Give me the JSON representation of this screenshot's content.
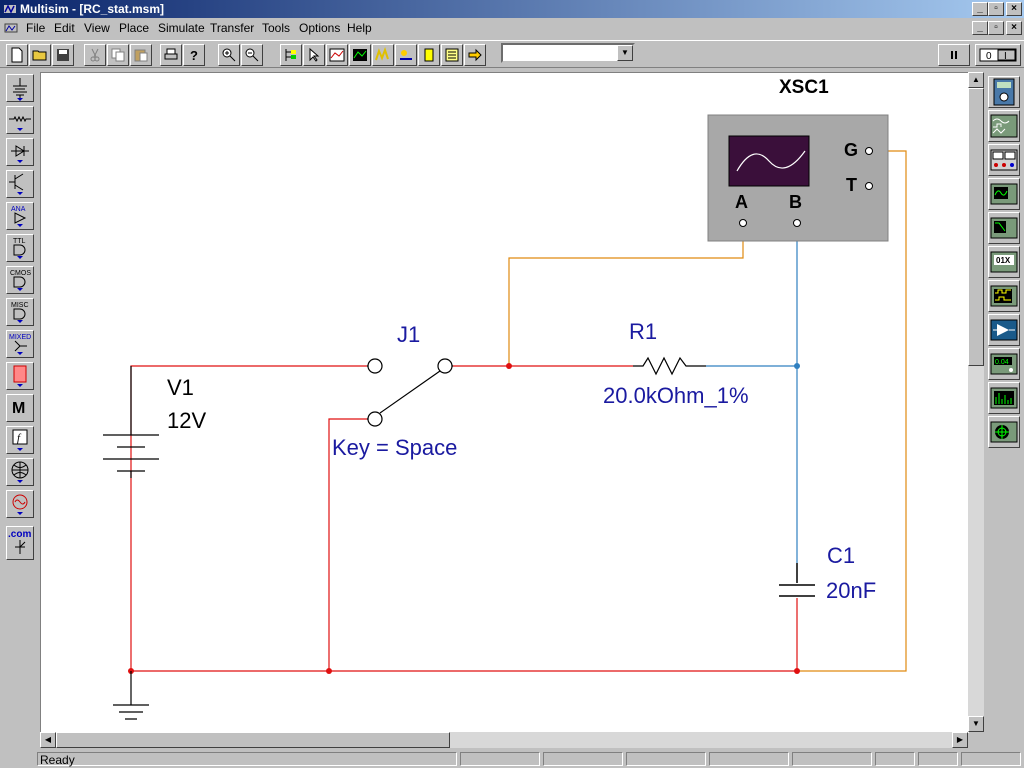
{
  "window": {
    "title": "Multisim - [RC_stat.msm]"
  },
  "menu": {
    "items": [
      "File",
      "Edit",
      "View",
      "Place",
      "Simulate",
      "Transfer",
      "Tools",
      "Options",
      "Help"
    ]
  },
  "toolbar": {
    "combo_value": ""
  },
  "left_toolbar": {
    "items": [
      "sources-icon",
      "basic-icon",
      "diodes-icon",
      "transistors-icon",
      "analog-icon",
      "ttl-icon",
      "cmos-icon",
      "misc-digital-icon",
      "mixed-icon",
      "indicators-icon",
      "misc-icon",
      "controls-icon",
      "rf-icon",
      "electromechanical-icon",
      "dotcom-icon"
    ],
    "labels": {
      "analog": "ANA",
      "ttl": "TTL",
      "cmos": "CMOS",
      "misc": "MISC",
      "mixed": "MIXED",
      "misc_component": "M",
      "dotcom": ".com"
    }
  },
  "right_toolbar": {
    "items": [
      "multimeter-icon",
      "function-generator-icon",
      "wattmeter-icon",
      "oscilloscope-icon",
      "bode-plotter-icon",
      "word-generator-icon",
      "logic-analyzer-icon",
      "logic-converter-icon",
      "distortion-analyzer-icon",
      "spectrum-analyzer-icon",
      "network-analyzer-icon"
    ],
    "labels": {
      "word_generator": "01X",
      "distortion": "0.04"
    }
  },
  "schematic": {
    "oscilloscope": {
      "ref": "XSC1",
      "ch_a": "A",
      "ch_b": "B",
      "ground": "G",
      "trigger": "T"
    },
    "source": {
      "ref": "V1",
      "value": "12V"
    },
    "switch": {
      "ref": "J1",
      "key": "Key = Space"
    },
    "resistor": {
      "ref": "R1",
      "value": "20.0kOhm_1%"
    },
    "capacitor": {
      "ref": "C1",
      "value": "20nF"
    },
    "colors": {
      "wire_red": "#e01010",
      "wire_blue": "#3080c0",
      "wire_orange": "#e08a10",
      "label_blue": "#1a1aa0",
      "scope_body": "#a8a8a8",
      "scope_screen": "#3a0f3a"
    }
  },
  "status": {
    "text": "Ready"
  }
}
